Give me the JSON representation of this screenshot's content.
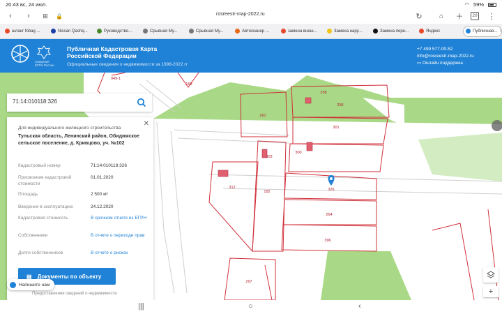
{
  "status": {
    "time": "20:43",
    "date": "вс, 24 июл.",
    "battery": "59%"
  },
  "browser": {
    "url": "rosreestr-map-2022.ru",
    "tab_count": "20"
  },
  "tabs": [
    {
      "label": "шланг fobag ...",
      "color": "#e8492a"
    },
    {
      "label": "Nissan Qashq...",
      "color": "#1c3faa"
    },
    {
      "label": "Руководство...",
      "color": "#4a8a2a"
    },
    {
      "label": "Срывная Му...",
      "color": "#777777"
    },
    {
      "label": "Срывная Му...",
      "color": "#777777"
    },
    {
      "label": "Автосканер ...",
      "color": "#e86a1a"
    },
    {
      "label": "замена внеш...",
      "color": "#e8492a"
    },
    {
      "label": "Замена нару...",
      "color": "#f0c419"
    },
    {
      "label": "Замена пере...",
      "color": "#111111"
    },
    {
      "label": "Яндекс",
      "color": "#e8492a"
    },
    {
      "label": "Публичная...",
      "color": "#1f82d6"
    }
  ],
  "header": {
    "title_line1": "Публичная Кадастровая Карта",
    "title_line2": "Российской Федерации",
    "subtitle": "Официальные сведения о недвижимости за 1998-2022 гг",
    "logo_caption_1": "Сведения",
    "logo_caption_2": "ЕГРН России",
    "phone": "+7 499 577-00-52",
    "email": "info@rosreestr-map-2022.ru",
    "support": "Онлайн поддержка"
  },
  "search": {
    "value": "71:14:010118:326"
  },
  "card": {
    "type": "Для индивидуального жилищного строительства",
    "address": "Тульская область, Ленинский район, Обидимское сельское поселение, д. Кривцово, уч. №102",
    "rows": [
      {
        "label": "Кадастровый номер",
        "value": "71:14:010118:326"
      },
      {
        "label": "Присвоение кадастровой стоимости",
        "value": "01.01.2020"
      },
      {
        "label": "Площадь",
        "value": "2 500 м²"
      },
      {
        "label": "Введение в эксплуатацию",
        "value": "24.12.2020"
      },
      {
        "label": "Кадастровая стоимость",
        "value": "В срочном отчете из ЕГРН"
      },
      {
        "label": "Собственники",
        "value": "В отчете о переходе прав"
      },
      {
        "label": "Долги собственников",
        "value": "В отчете о рисках"
      }
    ],
    "docs_button": "Документы по объекту",
    "footer": "Предоставление сведений о недвижимости"
  },
  "chat": {
    "label": "Напишите нам"
  },
  "map": {
    "parcels": [
      "949-1",
      "169",
      "258",
      "258",
      "261",
      "301",
      "300",
      "303",
      "182",
      "312",
      "326",
      "264",
      "396",
      "297"
    ]
  },
  "colors": {
    "brand": "#1f82d6",
    "map_green": "#a9d986",
    "parcel_line": "#d0303a"
  }
}
